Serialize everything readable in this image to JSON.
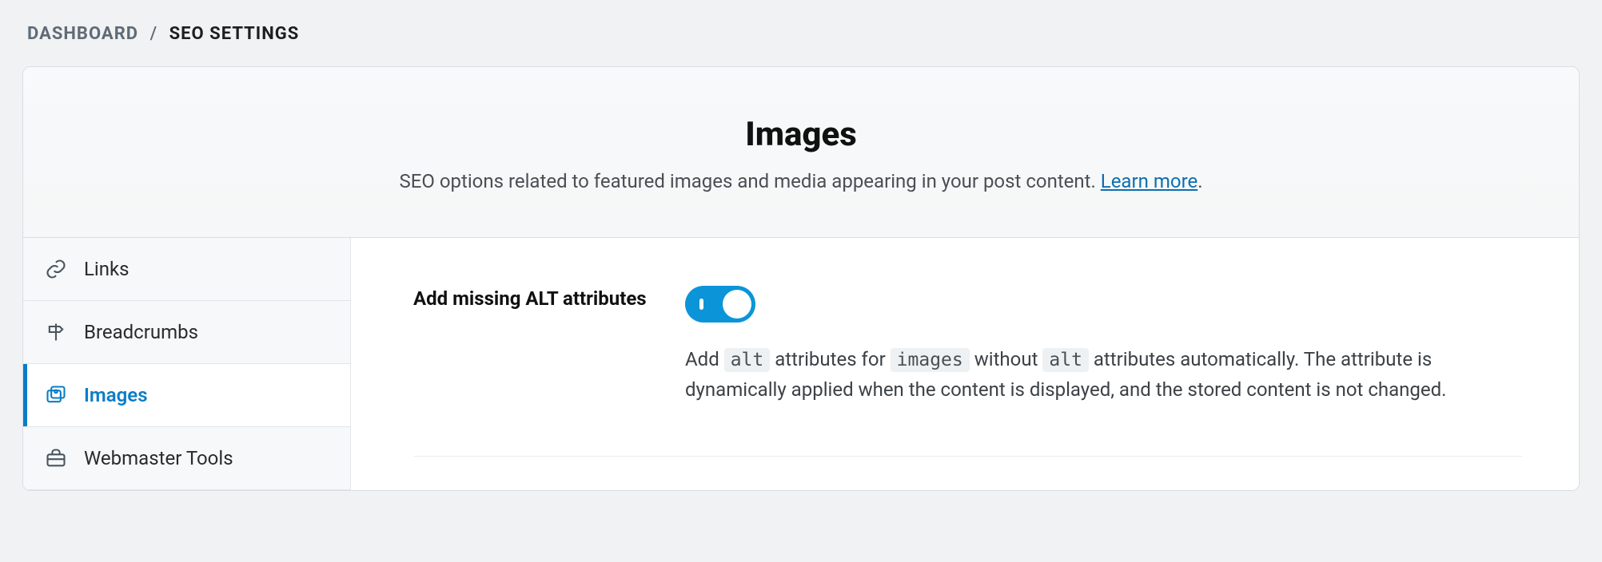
{
  "breadcrumb": {
    "root": "DASHBOARD",
    "current": "SEO SETTINGS"
  },
  "header": {
    "title": "Images",
    "subtitle_pre": "SEO options related to featured images and media appearing in your post content. ",
    "learn_more": "Learn more",
    "subtitle_post": "."
  },
  "sidebar": {
    "items": [
      {
        "label": "Links"
      },
      {
        "label": "Breadcrumbs"
      },
      {
        "label": "Images"
      },
      {
        "label": "Webmaster Tools"
      }
    ]
  },
  "setting": {
    "label": "Add missing ALT attributes",
    "toggle_on": true,
    "desc_parts": {
      "p1": "Add ",
      "c1": "alt",
      "p2": " attributes for ",
      "c2": "images",
      "p3": " without ",
      "c3": "alt",
      "p4": " attributes automatically. The attribute is dynamically applied when the content is displayed, and the stored content is not changed."
    }
  }
}
